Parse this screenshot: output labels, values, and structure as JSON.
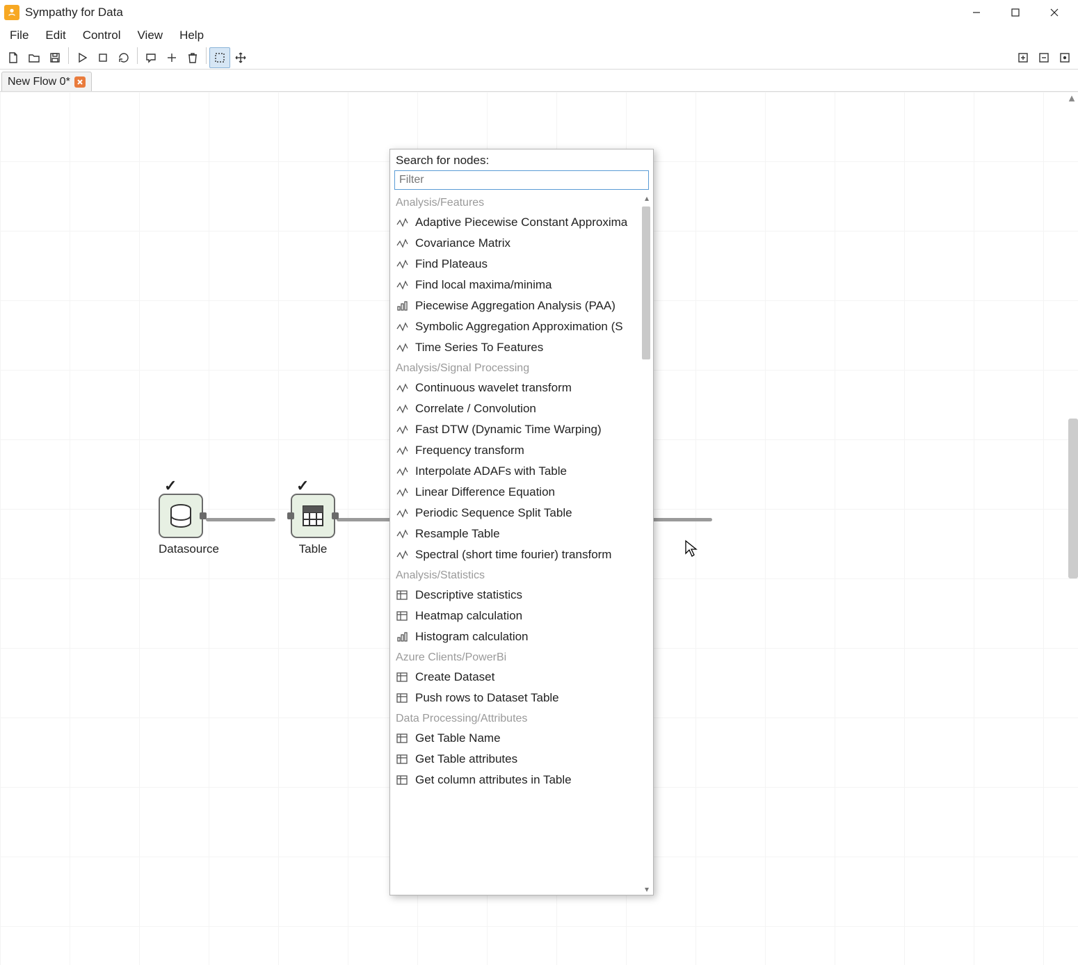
{
  "app": {
    "title": "Sympathy for Data"
  },
  "menu": {
    "items": [
      "File",
      "Edit",
      "Control",
      "View",
      "Help"
    ]
  },
  "toolbar": {
    "left_icons": [
      "new-file-icon",
      "open-folder-icon",
      "save-icon",
      "sep",
      "play-icon",
      "stop-icon",
      "reload-icon",
      "sep",
      "comment-icon",
      "plus-icon",
      "trash-icon",
      "sep",
      "selection-icon",
      "move-icon"
    ],
    "right_icons": [
      "zoom-in-icon",
      "zoom-out-icon",
      "fit-icon"
    ],
    "active_icon": "selection-icon"
  },
  "tab": {
    "label": "New Flow 0*"
  },
  "nodes": {
    "datasource": {
      "label": "Datasource",
      "checked": true
    },
    "table": {
      "label": "Table",
      "checked": true
    }
  },
  "popup": {
    "title": "Search for nodes:",
    "placeholder": "Filter",
    "value": "",
    "groups": [
      {
        "category": "Analysis/Features",
        "items": [
          {
            "icon": "wave-icon",
            "label": "Adaptive Piecewise Constant Approxima"
          },
          {
            "icon": "scatter-icon",
            "label": "Covariance Matrix"
          },
          {
            "icon": "plateau-icon",
            "label": "Find Plateaus"
          },
          {
            "icon": "extrema-icon",
            "label": "Find local maxima/minima"
          },
          {
            "icon": "bars-icon",
            "label": "Piecewise Aggregation Analysis (PAA)"
          },
          {
            "icon": "symbols-icon",
            "label": "Symbolic Aggregation Approximation (S"
          },
          {
            "icon": "arrow-right-icon",
            "label": "Time Series To Features"
          }
        ]
      },
      {
        "category": "Analysis/Signal Processing",
        "items": [
          {
            "icon": "wavelet-icon",
            "label": "Continuous wavelet transform"
          },
          {
            "icon": "correlate-icon",
            "label": "Correlate / Convolution"
          },
          {
            "icon": "dtw-icon",
            "label": "Fast DTW (Dynamic Time Warping)"
          },
          {
            "icon": "freq-icon",
            "label": "Frequency transform"
          },
          {
            "icon": "interp-icon",
            "label": "Interpolate ADAFs with Table"
          },
          {
            "icon": "diff-icon",
            "label": "Linear Difference Equation"
          },
          {
            "icon": "periodic-icon",
            "label": "Periodic Sequence Split Table"
          },
          {
            "icon": "resample-icon",
            "label": "Resample Table"
          },
          {
            "icon": "spectral-icon",
            "label": "Spectral (short time fourier) transform"
          }
        ]
      },
      {
        "category": "Analysis/Statistics",
        "items": [
          {
            "icon": "stats-icon",
            "label": "Descriptive statistics"
          },
          {
            "icon": "heatmap-icon",
            "label": "Heatmap calculation"
          },
          {
            "icon": "histogram-icon",
            "label": "Histogram calculation"
          }
        ]
      },
      {
        "category": "Azure Clients/PowerBi",
        "items": [
          {
            "icon": "dataset-icon",
            "label": "Create Dataset"
          },
          {
            "icon": "push-icon",
            "label": "Push rows to Dataset Table"
          }
        ]
      },
      {
        "category": "Data Processing/Attributes",
        "items": [
          {
            "icon": "table-icon",
            "label": "Get Table Name"
          },
          {
            "icon": "table-attr-icon",
            "label": "Get Table attributes"
          },
          {
            "icon": "col-attr-icon",
            "label": "Get column attributes in Table"
          }
        ]
      }
    ]
  }
}
